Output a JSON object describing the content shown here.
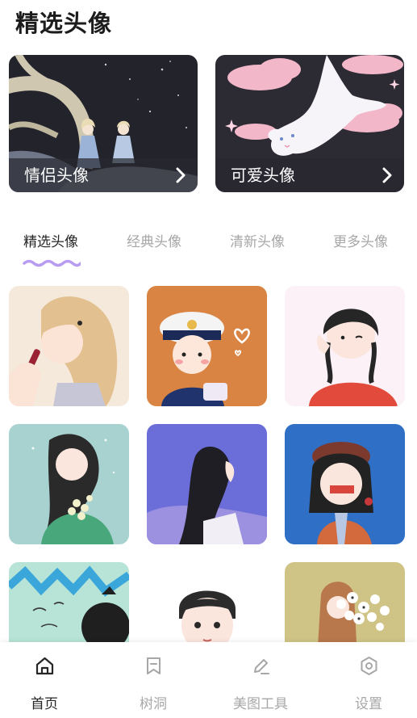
{
  "page": {
    "title": "精选头像"
  },
  "banners": [
    {
      "label": "情侣头像",
      "art": "couple-night-tree"
    },
    {
      "label": "可爱头像",
      "art": "white-cat-pink-clouds"
    }
  ],
  "tabs": [
    {
      "label": "精选头像",
      "active": true
    },
    {
      "label": "经典头像",
      "active": false
    },
    {
      "label": "清新头像",
      "active": false
    },
    {
      "label": "更多头像",
      "active": false
    }
  ],
  "avatars": [
    {
      "art": "girl-lipstick-cream"
    },
    {
      "art": "sailor-boy-orange"
    },
    {
      "art": "girl-wink-pink"
    },
    {
      "art": "girl-flowers-green"
    },
    {
      "art": "girl-profile-purple"
    },
    {
      "art": "girl-beret-blue"
    },
    {
      "art": "boy-teal-scribble"
    },
    {
      "art": "boy-white"
    },
    {
      "art": "girl-white-flowers-olive"
    }
  ],
  "bottom_nav": [
    {
      "label": "首页",
      "icon": "home-icon",
      "active": true
    },
    {
      "label": "树洞",
      "icon": "bookmark-icon",
      "active": false
    },
    {
      "label": "美图工具",
      "icon": "pen-icon",
      "active": false
    },
    {
      "label": "设置",
      "icon": "settings-hexagon-icon",
      "active": false
    }
  ],
  "colors": {
    "accent_wave": "#b79cf2",
    "active_text": "#262626",
    "inactive_text": "#a7a7a7"
  }
}
